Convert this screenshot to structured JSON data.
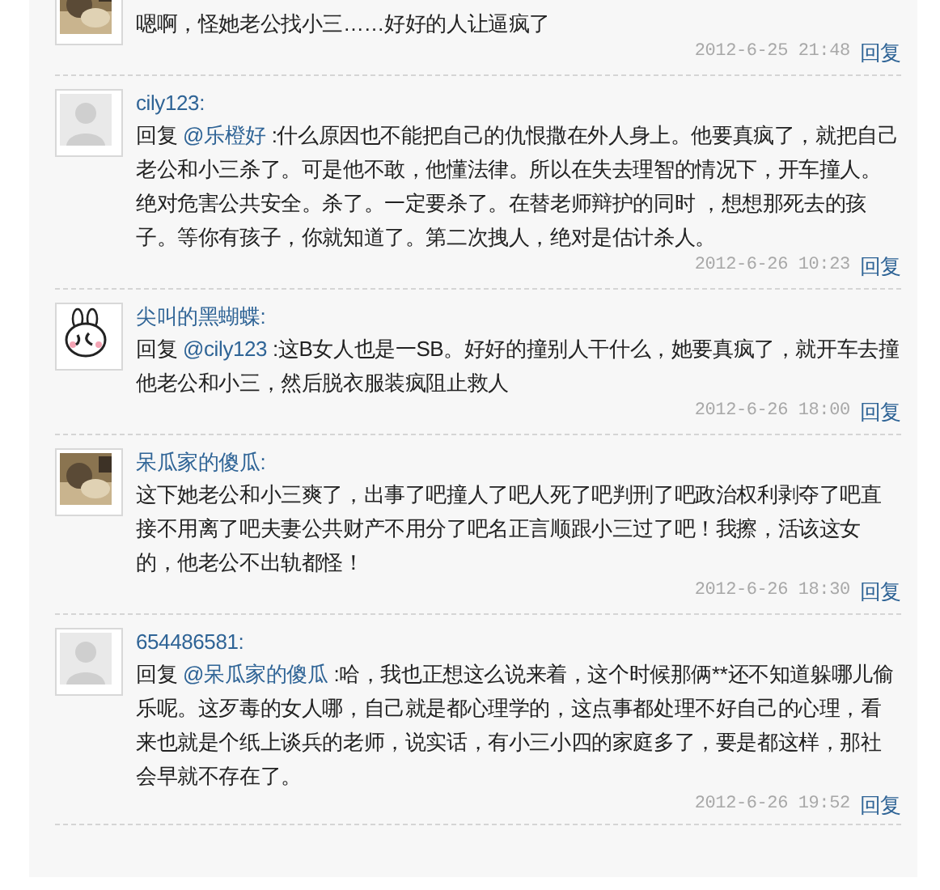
{
  "comments": [
    {
      "text": "嗯啊，怪她老公找小三……好好的人让逼疯了",
      "time": "2012-6-25 21:48",
      "reply_link": "回复"
    },
    {
      "avatar": {
        "kind": "default"
      },
      "name": "cily123:",
      "reply_prefix": "回复",
      "reply_to": "@乐橙好",
      "text": " :什么原因也不能把自己的仇恨撒在外人身上。他要真疯了，就把自己老公和小三杀了。可是他不敢，他懂法律。所以在失去理智的情况下，开车撞人。绝对危害公共安全。杀了。一定要杀了。在替老师辩护的同时 ，想想那死去的孩子。等你有孩子，你就知道了。第二次拽人，绝对是估计杀人。",
      "time": "2012-6-26 10:23",
      "reply_link": "回复"
    },
    {
      "avatar": {
        "kind": "cartoon"
      },
      "name": "尖叫的黑蝴蝶:",
      "reply_prefix": "回复",
      "reply_to": "@cily123",
      "text": " :这B女人也是一SB。好好的撞别人干什么，她要真疯了，就开车去撞他老公和小三，然后脱衣服装疯阻止救人",
      "time": "2012-6-26 18:00",
      "reply_link": "回复"
    },
    {
      "name": "呆瓜家的傻瓜:",
      "text": "这下她老公和小三爽了，出事了吧撞人了吧人死了吧判刑了吧政治权利剥夺了吧直接不用离了吧夫妻公共财产不用分了吧名正言顺跟小三过了吧！我擦，活该这女的，他老公不出轨都怪！",
      "time": "2012-6-26 18:30",
      "reply_link": "回复"
    },
    {
      "avatar": {
        "kind": "default"
      },
      "name": "654486581:",
      "reply_prefix": "回复",
      "reply_to": "@呆瓜家的傻瓜",
      "text": " :哈，我也正想这么说来着，这个时候那俩**还不知道躲哪儿偷乐呢。这歹毒的女人哪，自己就是都心理学的，这点事都处理不好自己的心理，看来也就是个纸上谈兵的老师，说实话，有小三小四的家庭多了，要是都这样，那社会早就不存在了。",
      "time": "2012-6-26 19:52",
      "reply_link": "回复"
    }
  ]
}
